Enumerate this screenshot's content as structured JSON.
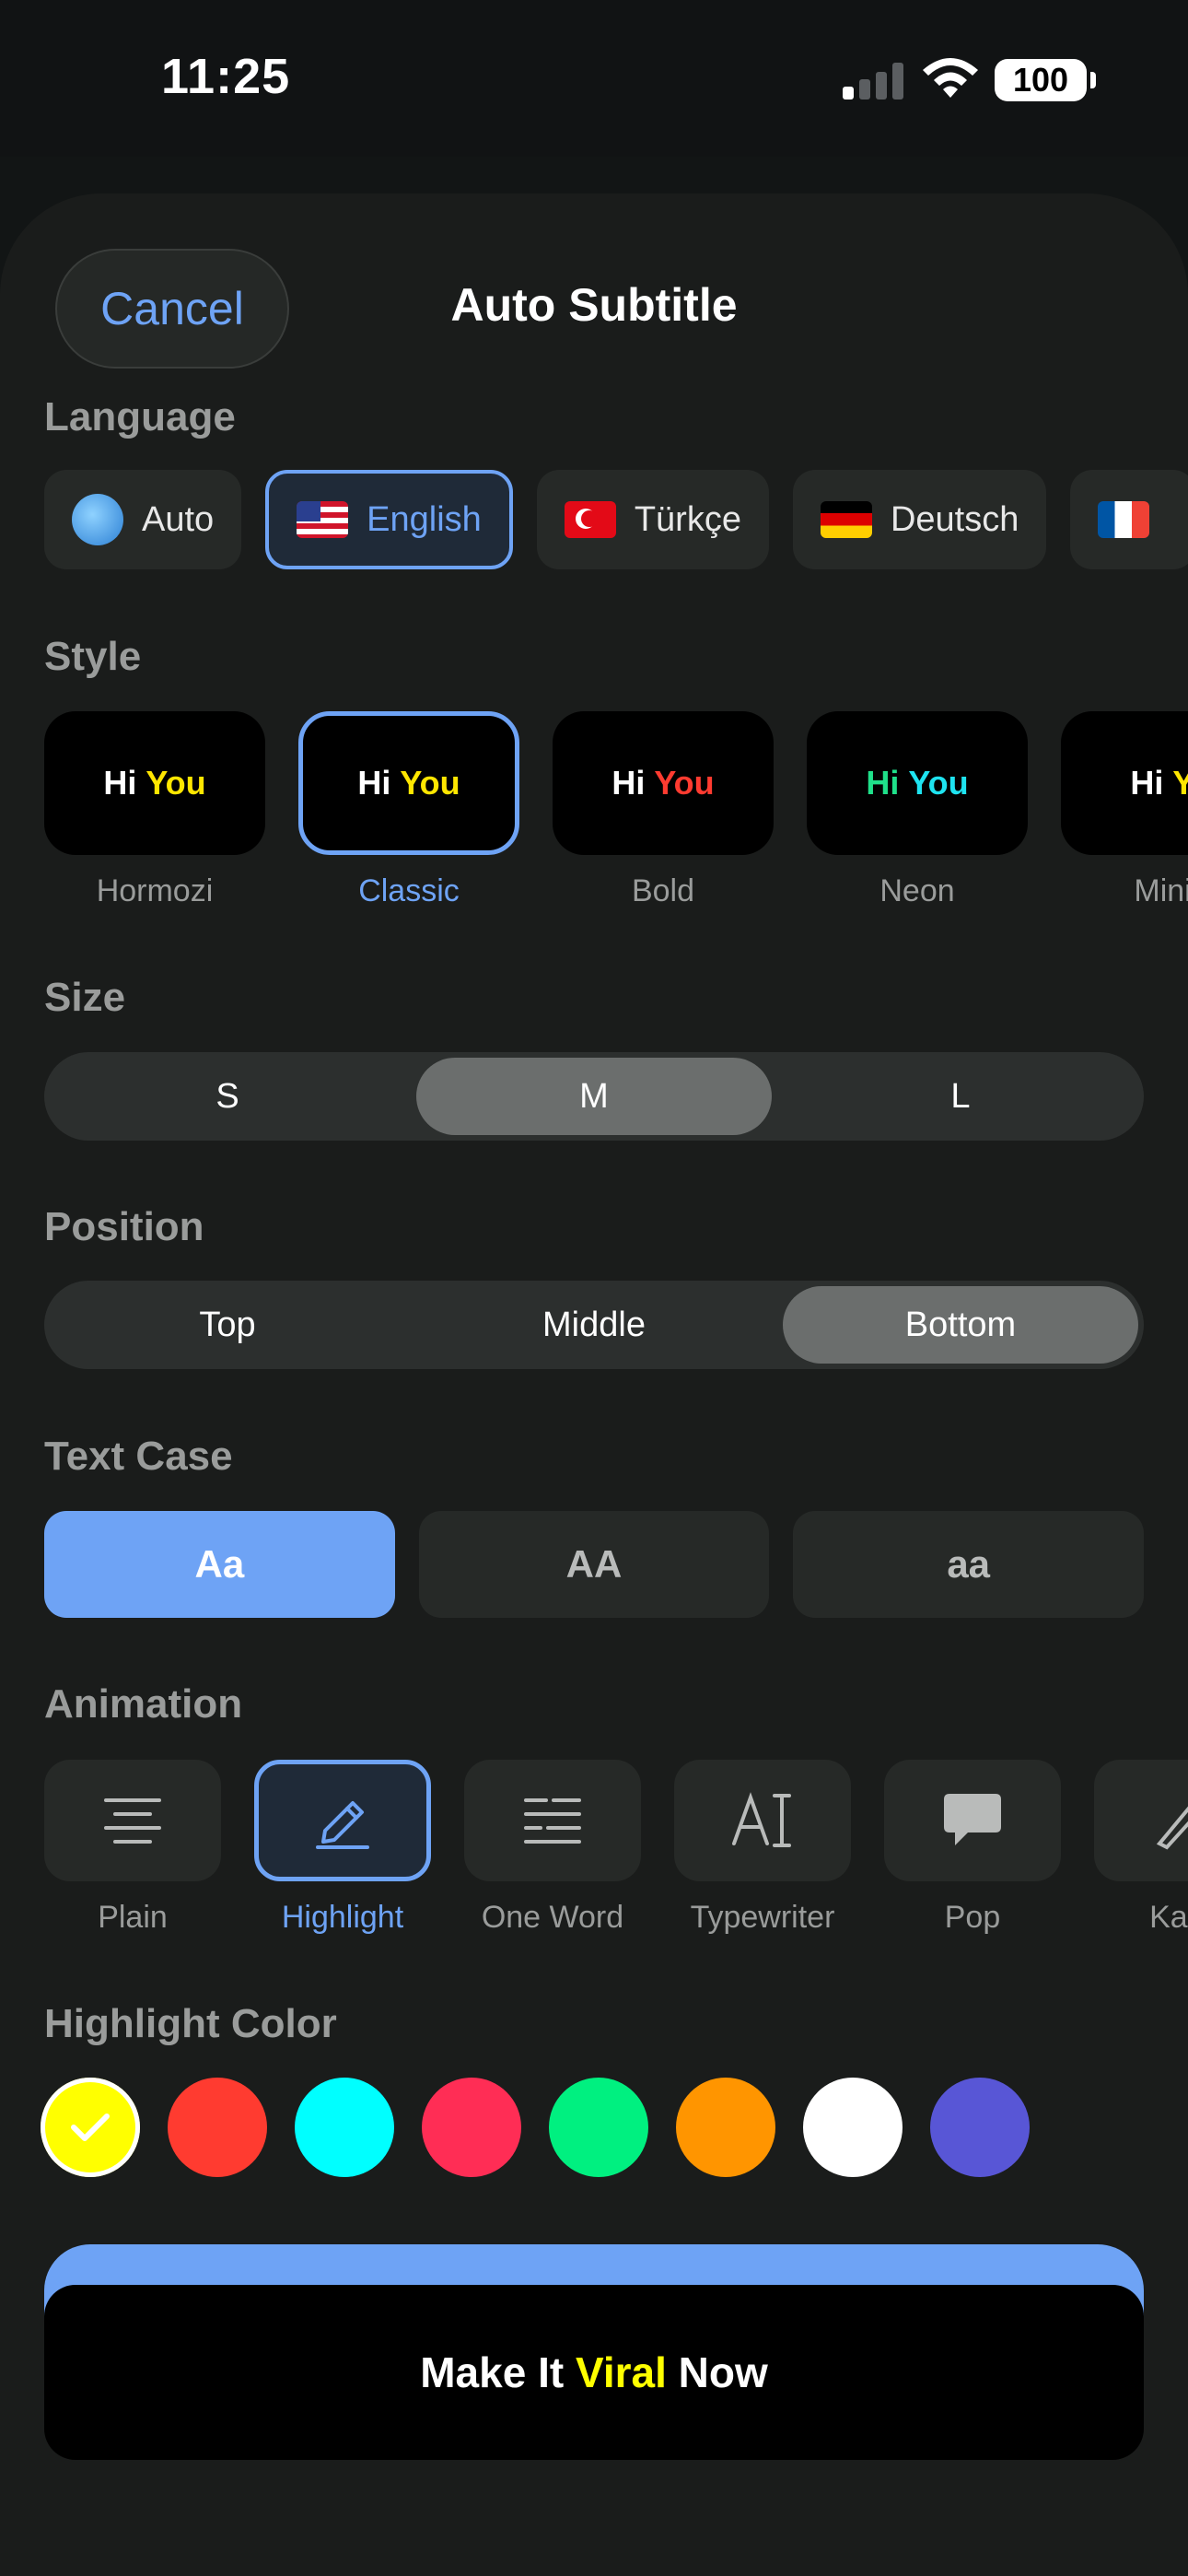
{
  "status": {
    "time": "11:25",
    "battery": "100"
  },
  "header": {
    "cancel_label": "Cancel",
    "title": "Auto Subtitle"
  },
  "sections": {
    "language": "Language",
    "style": "Style",
    "size": "Size",
    "position": "Position",
    "text_case": "Text Case",
    "animation": "Animation",
    "highlight_color": "Highlight Color"
  },
  "languages": [
    {
      "label": "Auto",
      "flag": "globe-icon",
      "active": false
    },
    {
      "label": "English",
      "flag": "us-flag-icon",
      "active": true
    },
    {
      "label": "Türkçe",
      "flag": "tr-flag-icon",
      "active": false
    },
    {
      "label": "Deutsch",
      "flag": "de-flag-icon",
      "active": false
    },
    {
      "label": "",
      "flag": "fr-flag-icon",
      "active": false
    }
  ],
  "styles": [
    {
      "name": "Hormozi",
      "w1": "Hi",
      "w2": "You",
      "c1": "#ffffff",
      "c2": "#ffe600",
      "active": false
    },
    {
      "name": "Classic",
      "w1": "Hi",
      "w2": "You",
      "c1": "#ffffff",
      "c2": "#ffe600",
      "active": true
    },
    {
      "name": "Bold",
      "w1": "Hi",
      "w2": "You",
      "c1": "#ffffff",
      "c2": "#ff3b30",
      "active": false
    },
    {
      "name": "Neon",
      "w1": "Hi",
      "w2": "You",
      "c1": "#1fe08a",
      "c2": "#1ee3f0",
      "active": false
    },
    {
      "name": "Minin",
      "w1": "Hi",
      "w2": "Yo",
      "c1": "#ffffff",
      "c2": "#ffe600",
      "active": false
    }
  ],
  "size_options": [
    "S",
    "M",
    "L"
  ],
  "size_selected": "M",
  "position_options": [
    "Top",
    "Middle",
    "Bottom"
  ],
  "position_selected": "Bottom",
  "text_case_options": [
    "Aa",
    "AA",
    "aa"
  ],
  "text_case_selected": "Aa",
  "animations": [
    {
      "name": "Plain",
      "icon": "align-center-icon",
      "active": false
    },
    {
      "name": "Highlight",
      "icon": "pencil-icon",
      "active": true
    },
    {
      "name": "One Word",
      "icon": "text-lines-icon",
      "active": false
    },
    {
      "name": "Typewriter",
      "icon": "text-cursor-icon",
      "active": false
    },
    {
      "name": "Pop",
      "icon": "speech-bubble-icon",
      "active": false
    },
    {
      "name": "Kara",
      "icon": "pen-icon",
      "active": false
    }
  ],
  "highlight_colors": [
    "#ffff00",
    "#ff3b30",
    "#00ffff",
    "#ff2d55",
    "#00f080",
    "#ff9500",
    "#ffffff",
    "#5856d6"
  ],
  "highlight_selected": "#ffff00",
  "cta": {
    "part1": "Make It ",
    "highlight": "Viral",
    "part2": " Now",
    "highlight_color": "#ffff00"
  },
  "colors": {
    "accent": "#6ea3f5"
  }
}
